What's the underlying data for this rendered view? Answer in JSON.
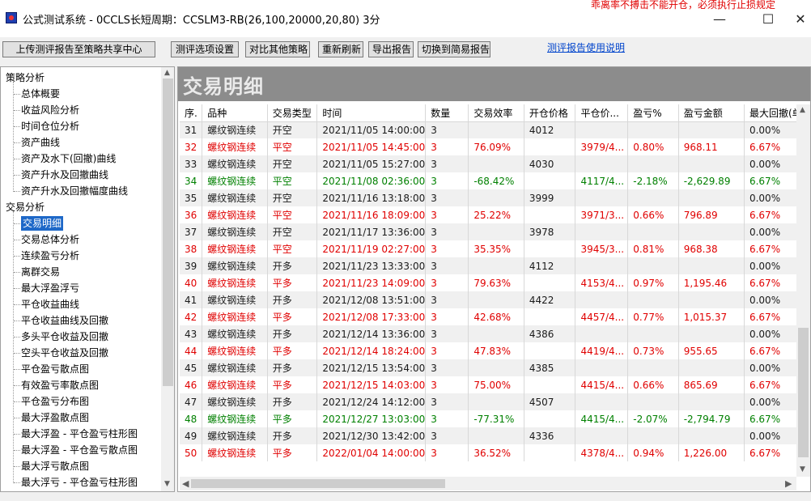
{
  "window": {
    "title": "公式测试系统 - 0CCLS长短周期：CCSLM3-RB(26,100,20000,20,80) 3分",
    "overlay_text": "乖离率不搏击不能开仓，必须执行止损规定",
    "min_label": "—",
    "max_label": "☐",
    "close_label": "✕"
  },
  "toolbar": {
    "upload_label": "上传测评报告至策略共享中心",
    "options_label": "测评选项设置",
    "compare_label": "对比其他策略",
    "refresh_label": "重新刷新",
    "export_label": "导出报告",
    "switch_label": "切换到简易报告",
    "help_link": "测评报告使用说明"
  },
  "tree": {
    "group1": "策略分析",
    "group1_items": [
      "总体概要",
      "收益风险分析",
      "时间仓位分析",
      "资产曲线",
      "资产及水下(回撤)曲线",
      "资产升水及回撤曲线",
      "资产升水及回撤幅度曲线"
    ],
    "group2": "交易分析",
    "group2_items": [
      "交易明细",
      "交易总体分析",
      "连续盈亏分析",
      "离群交易",
      "最大浮盈浮亏",
      "平仓收益曲线",
      "平仓收益曲线及回撤",
      "多头平仓收益及回撤",
      "空头平仓收益及回撤",
      "平仓盈亏散点图",
      "有效盈亏率散点图",
      "平仓盈亏分布图",
      "最大浮盈散点图",
      "最大浮盈 - 平仓盈亏柱形图",
      "最大浮盈 - 平仓盈亏散点图",
      "最大浮亏散点图",
      "最大浮亏 - 平仓盈亏柱形图"
    ],
    "selected": "交易明细"
  },
  "main": {
    "title": "交易明细",
    "columns": [
      "序.",
      "品种",
      "交易类型",
      "时间",
      "数量",
      "交易效率",
      "开仓价格",
      "平仓价...",
      "盈亏%",
      "盈亏金额",
      "最大回撤(单"
    ],
    "rows": [
      {
        "c": "dark",
        "v": [
          "31",
          "螺纹钢连续",
          "开空",
          "2021/11/05 14:00:00",
          "3",
          "",
          "4012",
          "",
          "",
          "",
          "0.00%"
        ]
      },
      {
        "c": "red",
        "v": [
          "32",
          "螺纹钢连续",
          "平空",
          "2021/11/05 14:45:00",
          "3",
          "76.09%",
          "",
          "3979/4...",
          "0.80%",
          "968.11",
          "6.67%"
        ]
      },
      {
        "c": "dark",
        "v": [
          "33",
          "螺纹钢连续",
          "开空",
          "2021/11/05 15:27:00",
          "3",
          "",
          "4030",
          "",
          "",
          "",
          "0.00%"
        ]
      },
      {
        "c": "green",
        "v": [
          "34",
          "螺纹钢连续",
          "平空",
          "2021/11/08 02:36:00",
          "3",
          "-68.42%",
          "",
          "4117/4...",
          "-2.18%",
          "-2,629.89",
          "6.67%"
        ]
      },
      {
        "c": "dark",
        "v": [
          "35",
          "螺纹钢连续",
          "开空",
          "2021/11/16 13:18:00",
          "3",
          "",
          "3999",
          "",
          "",
          "",
          "0.00%"
        ]
      },
      {
        "c": "red",
        "v": [
          "36",
          "螺纹钢连续",
          "平空",
          "2021/11/16 18:09:00",
          "3",
          "25.22%",
          "",
          "3971/3...",
          "0.66%",
          "796.89",
          "6.67%"
        ]
      },
      {
        "c": "dark",
        "v": [
          "37",
          "螺纹钢连续",
          "开空",
          "2021/11/17 13:36:00",
          "3",
          "",
          "3978",
          "",
          "",
          "",
          "0.00%"
        ]
      },
      {
        "c": "red",
        "v": [
          "38",
          "螺纹钢连续",
          "平空",
          "2021/11/19 02:27:00",
          "3",
          "35.35%",
          "",
          "3945/3...",
          "0.81%",
          "968.38",
          "6.67%"
        ]
      },
      {
        "c": "dark",
        "v": [
          "39",
          "螺纹钢连续",
          "开多",
          "2021/11/23 13:33:00",
          "3",
          "",
          "4112",
          "",
          "",
          "",
          "0.00%"
        ]
      },
      {
        "c": "red",
        "v": [
          "40",
          "螺纹钢连续",
          "平多",
          "2021/11/23 14:09:00",
          "3",
          "79.63%",
          "",
          "4153/4...",
          "0.97%",
          "1,195.46",
          "6.67%"
        ]
      },
      {
        "c": "dark",
        "v": [
          "41",
          "螺纹钢连续",
          "开多",
          "2021/12/08 13:51:00",
          "3",
          "",
          "4422",
          "",
          "",
          "",
          "0.00%"
        ]
      },
      {
        "c": "red",
        "v": [
          "42",
          "螺纹钢连续",
          "平多",
          "2021/12/08 17:33:00",
          "3",
          "42.68%",
          "",
          "4457/4...",
          "0.77%",
          "1,015.37",
          "6.67%"
        ]
      },
      {
        "c": "dark",
        "v": [
          "43",
          "螺纹钢连续",
          "开多",
          "2021/12/14 13:36:00",
          "3",
          "",
          "4386",
          "",
          "",
          "",
          "0.00%"
        ]
      },
      {
        "c": "red",
        "v": [
          "44",
          "螺纹钢连续",
          "平多",
          "2021/12/14 18:24:00",
          "3",
          "47.83%",
          "",
          "4419/4...",
          "0.73%",
          "955.65",
          "6.67%"
        ]
      },
      {
        "c": "dark",
        "v": [
          "45",
          "螺纹钢连续",
          "开多",
          "2021/12/15 13:54:00",
          "3",
          "",
          "4385",
          "",
          "",
          "",
          "0.00%"
        ]
      },
      {
        "c": "red",
        "v": [
          "46",
          "螺纹钢连续",
          "平多",
          "2021/12/15 14:03:00",
          "3",
          "75.00%",
          "",
          "4415/4...",
          "0.66%",
          "865.69",
          "6.67%"
        ]
      },
      {
        "c": "dark",
        "v": [
          "47",
          "螺纹钢连续",
          "开多",
          "2021/12/24 14:12:00",
          "3",
          "",
          "4507",
          "",
          "",
          "",
          "0.00%"
        ]
      },
      {
        "c": "green",
        "v": [
          "48",
          "螺纹钢连续",
          "平多",
          "2021/12/27 13:03:00",
          "3",
          "-77.31%",
          "",
          "4415/4...",
          "-2.07%",
          "-2,794.79",
          "6.67%"
        ]
      },
      {
        "c": "dark",
        "v": [
          "49",
          "螺纹钢连续",
          "开多",
          "2021/12/30 13:42:00",
          "3",
          "",
          "4336",
          "",
          "",
          "",
          "0.00%"
        ]
      },
      {
        "c": "red",
        "v": [
          "50",
          "螺纹钢连续",
          "平多",
          "2022/01/04 14:00:00",
          "3",
          "36.52%",
          "",
          "4378/4...",
          "0.94%",
          "1,226.00",
          "6.67%"
        ]
      }
    ]
  },
  "colors": {
    "profit": "#e00000",
    "loss": "#008000",
    "selection": "#1e68c8",
    "header_band": "#8c8c8c"
  }
}
